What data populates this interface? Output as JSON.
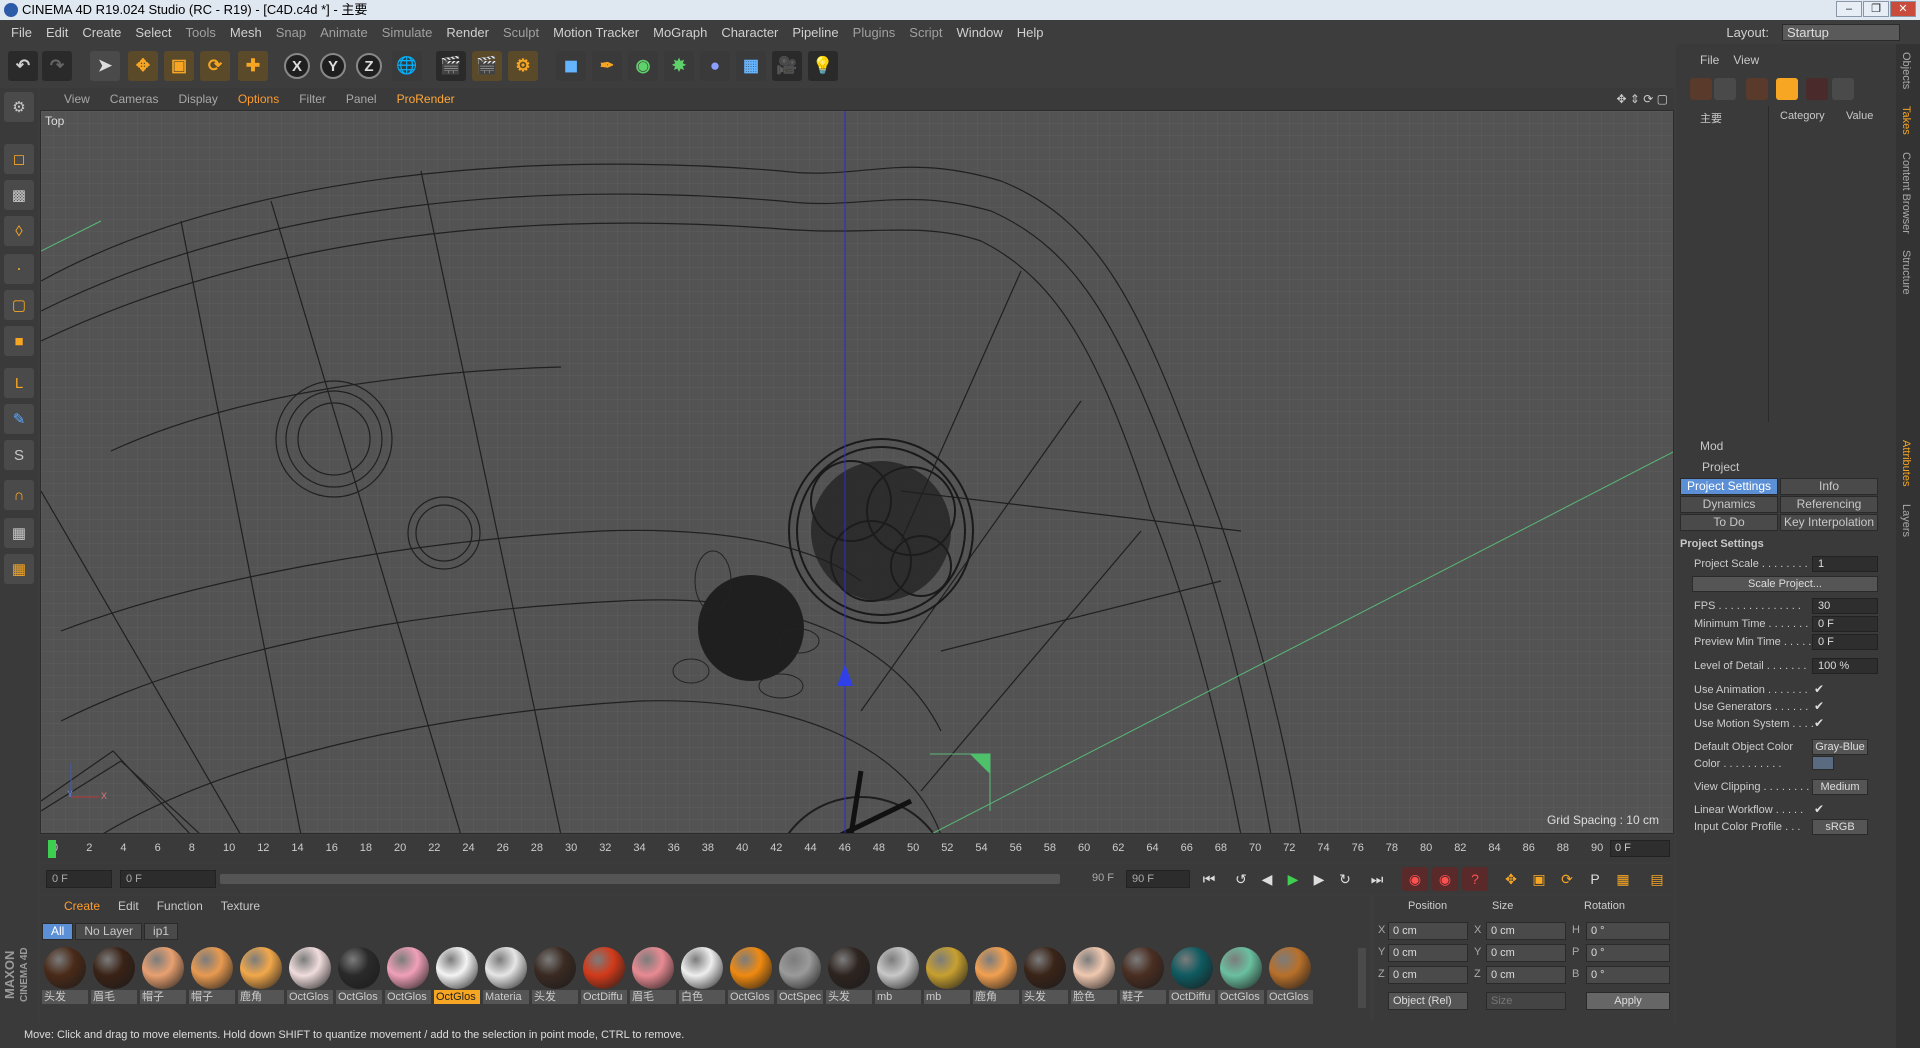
{
  "window": {
    "title": "CINEMA 4D R19.024 Studio (RC - R19) - [C4D.c4d *] - 主要"
  },
  "menu": [
    {
      "label": "File"
    },
    {
      "label": "Edit"
    },
    {
      "label": "Create"
    },
    {
      "label": "Select"
    },
    {
      "label": "Tools"
    },
    {
      "label": "Mesh"
    },
    {
      "label": "Snap"
    },
    {
      "label": "Animate"
    },
    {
      "label": "Simulate"
    },
    {
      "label": "Render"
    },
    {
      "label": "Sculpt"
    },
    {
      "label": "Motion Tracker"
    },
    {
      "label": "MoGraph"
    },
    {
      "label": "Character"
    },
    {
      "label": "Pipeline"
    },
    {
      "label": "Plugins"
    },
    {
      "label": "Script"
    },
    {
      "label": "Window"
    },
    {
      "label": "Help"
    }
  ],
  "layout": {
    "label": "Layout:",
    "value": "Startup"
  },
  "toolbar": {
    "x_axis": "X",
    "y_axis": "Y",
    "z_axis": "Z"
  },
  "viewport": {
    "menu": [
      "View",
      "Cameras",
      "Display",
      "Options",
      "Filter",
      "Panel",
      "ProRender"
    ],
    "label": "Top",
    "grid_spacing": "Grid Spacing : 10 cm",
    "axis_y": "Y",
    "axis_x": "X"
  },
  "timeline": {
    "ticks": [
      "0",
      "2",
      "4",
      "6",
      "8",
      "10",
      "12",
      "14",
      "16",
      "18",
      "20",
      "22",
      "24",
      "26",
      "28",
      "30",
      "32",
      "34",
      "36",
      "38",
      "40",
      "42",
      "44",
      "46",
      "48",
      "50",
      "52",
      "54",
      "56",
      "58",
      "60",
      "62",
      "64",
      "66",
      "68",
      "70",
      "72",
      "74",
      "76",
      "78",
      "80",
      "82",
      "84",
      "86",
      "88",
      "90"
    ],
    "current_frame": "0 F",
    "start": "0 F",
    "range_start": "0 F",
    "range_end": "90 F",
    "end": "90 F"
  },
  "materials": {
    "menu": [
      "Create",
      "Edit",
      "Function",
      "Texture"
    ],
    "tabs": [
      "All",
      "No Layer",
      "ip1"
    ],
    "items": [
      {
        "label": "头发",
        "color": "#4a2a18"
      },
      {
        "label": "眉毛",
        "color": "#3a2216"
      },
      {
        "label": "帽子",
        "color": "#e8a070"
      },
      {
        "label": "帽子",
        "color": "#e89a50"
      },
      {
        "label": "鹿角",
        "color": "#f2a84a"
      },
      {
        "label": "OctGlos",
        "color": "#f0dcdc"
      },
      {
        "label": "OctGlos",
        "color": "#2a2a2a"
      },
      {
        "label": "OctGlos",
        "color": "#f0a0b8"
      },
      {
        "label": "OctGlos",
        "color": "#f4f4f4",
        "selected": true
      },
      {
        "label": "Materia",
        "color": "#e6e6e6"
      },
      {
        "label": "头发",
        "color": "#3a2a22"
      },
      {
        "label": "OctDiffu",
        "color": "#d23a1a"
      },
      {
        "label": "眉毛",
        "color": "#e88a92"
      },
      {
        "label": "白色",
        "color": "#eeeeee"
      },
      {
        "label": "OctGlos",
        "color": "#f08a10"
      },
      {
        "label": "OctSpec",
        "color": "#9a9a9a"
      },
      {
        "label": "头发",
        "color": "#2e2420"
      },
      {
        "label": "mb",
        "color": "#c8c8c8"
      },
      {
        "label": "mb",
        "color": "#c8a030"
      },
      {
        "label": "鹿角",
        "color": "#f2a050"
      },
      {
        "label": "头发",
        "color": "#3a2418"
      },
      {
        "label": "脸色",
        "color": "#f0c8b0"
      },
      {
        "label": "鞋子",
        "color": "#4a2e22"
      },
      {
        "label": "OctDiffu",
        "color": "#0e5a60"
      },
      {
        "label": "OctGlos",
        "color": "#6ac0a0"
      },
      {
        "label": "OctGlos",
        "color": "#b8702a"
      }
    ]
  },
  "coords": {
    "headers": [
      "Position",
      "Size",
      "Rotation"
    ],
    "pos": [
      "0 cm",
      "0 cm",
      "0 cm"
    ],
    "size": [
      "0 cm",
      "0 cm",
      "0 cm"
    ],
    "rot": [
      "0 °",
      "0 °",
      "0 °"
    ],
    "pos_letters": [
      "X",
      "Y",
      "Z"
    ],
    "size_letters": [
      "X",
      "Y",
      "Z"
    ],
    "rot_letters": [
      "H",
      "P",
      "B"
    ],
    "mode": "Object (Rel)",
    "size_mode": "Size",
    "apply": "Apply"
  },
  "objects": {
    "menu": [
      "File",
      "View"
    ],
    "root": "主要",
    "columns": [
      "Category",
      "Value"
    ]
  },
  "attributes": {
    "menu": "Mod",
    "title": "Project",
    "tabs": [
      "Project Settings",
      "Info",
      "Dynamics",
      "Referencing",
      "To Do",
      "Key Interpolation"
    ],
    "section": "Project Settings",
    "fields": [
      {
        "label": "Project Scale . . . . . . . .",
        "value": "1"
      },
      {
        "label": "FPS . . . . . . . . . . . . . .",
        "value": "30"
      },
      {
        "label": "Minimum Time . . . . . . . .",
        "value": "0 F"
      },
      {
        "label": "Preview Min Time . . . . .",
        "value": "0 F"
      },
      {
        "label": "Level of Detail . . . . . . .",
        "value": "100 %"
      }
    ],
    "scale_button": "Scale Project...",
    "checks": [
      {
        "label": "Use Animation . . . . . . .",
        "value": "✔"
      },
      {
        "label": "Use Generators . . . . . .",
        "value": "✔"
      },
      {
        "label": "Use Motion System . . . .",
        "value": "✔"
      }
    ],
    "default_color_label": "Default Object Color",
    "default_color_value": "Gray-Blue",
    "color_label": "Color . . . . . . . . . .",
    "clipping_label": "View Clipping . . . . . . . .",
    "clipping_value": "Medium",
    "linear_label": "Linear Workflow . . . . .",
    "linear_value": "✔",
    "profile_label": "Input Color Profile . . .",
    "profile_value": "sRGB"
  },
  "right_tabs": [
    "Objects",
    "Takes",
    "Content Browser",
    "Structure",
    "Attributes",
    "Layers"
  ],
  "status": {
    "text": "Move: Click and drag to move elements. Hold down SHIFT to quantize movement / add to the selection in point mode, CTRL to remove."
  },
  "brand": {
    "line1": "MAXON",
    "line2": "CINEMA 4D"
  }
}
